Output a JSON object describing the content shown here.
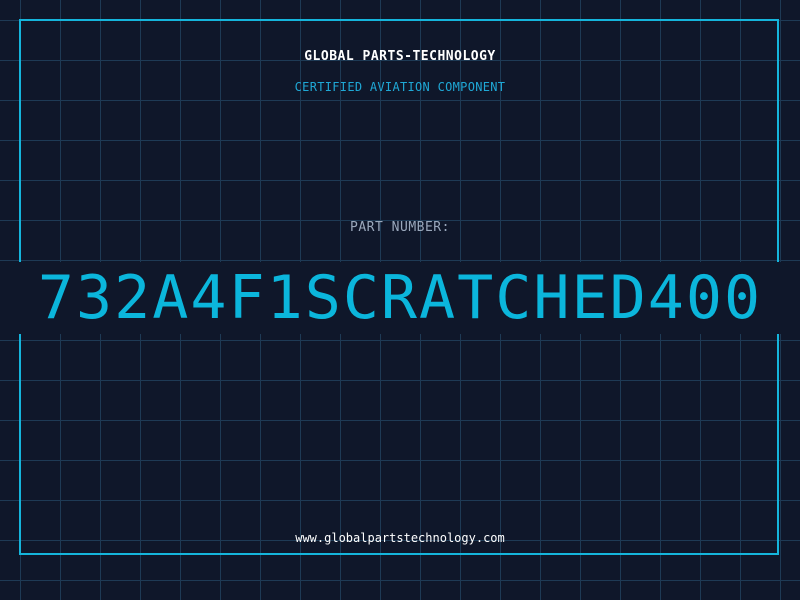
{
  "header": {
    "company": "GLOBAL PARTS-TECHNOLOGY",
    "subtitle": "CERTIFIED AVIATION COMPONENT"
  },
  "part": {
    "label": "PART NUMBER:",
    "value": "732A4F1SCRATCHED400"
  },
  "footer": {
    "url": "www.globalpartstechnology.com"
  },
  "colors": {
    "background": "#0f172a",
    "grid": "#1e3a55",
    "accent": "#15b5dc",
    "part_number": "#0bb6dc",
    "label": "#9aa8bc"
  }
}
